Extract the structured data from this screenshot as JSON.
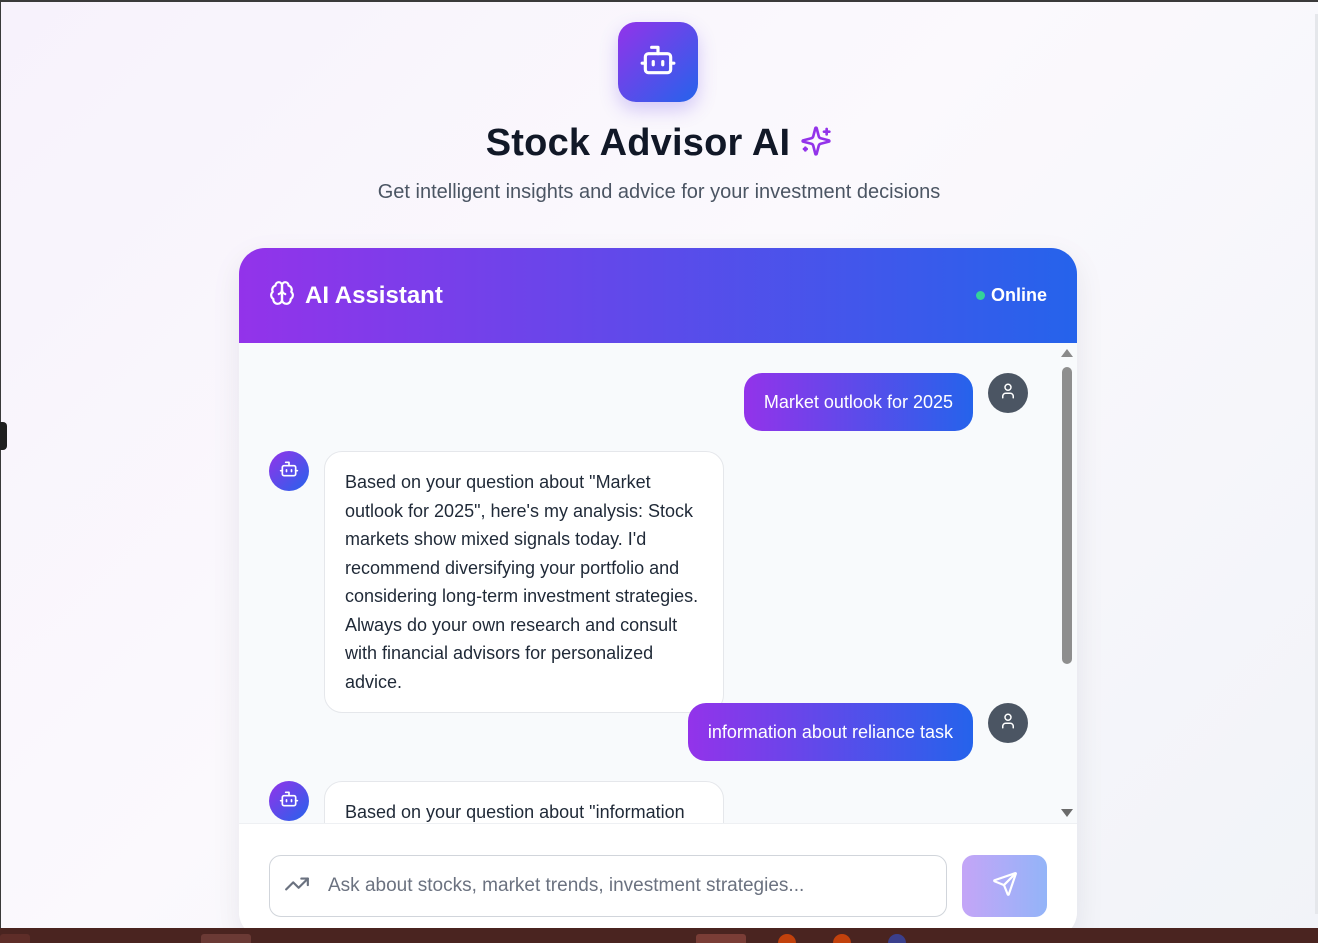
{
  "app": {
    "title": "Stock Advisor AI",
    "subtitle": "Get intelligent insights and advice for your investment decisions",
    "logo_icon": "robot-icon",
    "title_icon": "sparkles-icon"
  },
  "chat": {
    "header_title": "AI Assistant",
    "header_icon": "brain-icon",
    "status_label": "Online",
    "status_color": "#34d399",
    "messages": [
      {
        "role": "user",
        "text": "Market outlook for 2025"
      },
      {
        "role": "assistant",
        "text": "Based on your question about \"Market outlook for 2025\", here's my analysis: Stock markets show mixed signals today. I'd recommend diversifying your portfolio and considering long-term investment strategies. Always do your own research and consult with financial advisors for personalized advice."
      },
      {
        "role": "user",
        "text": "information about reliance task"
      },
      {
        "role": "assistant",
        "text": "Based on your question about \"information"
      }
    ]
  },
  "composer": {
    "placeholder": "Ask about stocks, market trends, investment strategies...",
    "value": "",
    "leading_icon": "trending-up-icon",
    "send_icon": "send-icon"
  },
  "theme": {
    "gradient_start": "#9333ea",
    "gradient_end": "#2563eb"
  }
}
